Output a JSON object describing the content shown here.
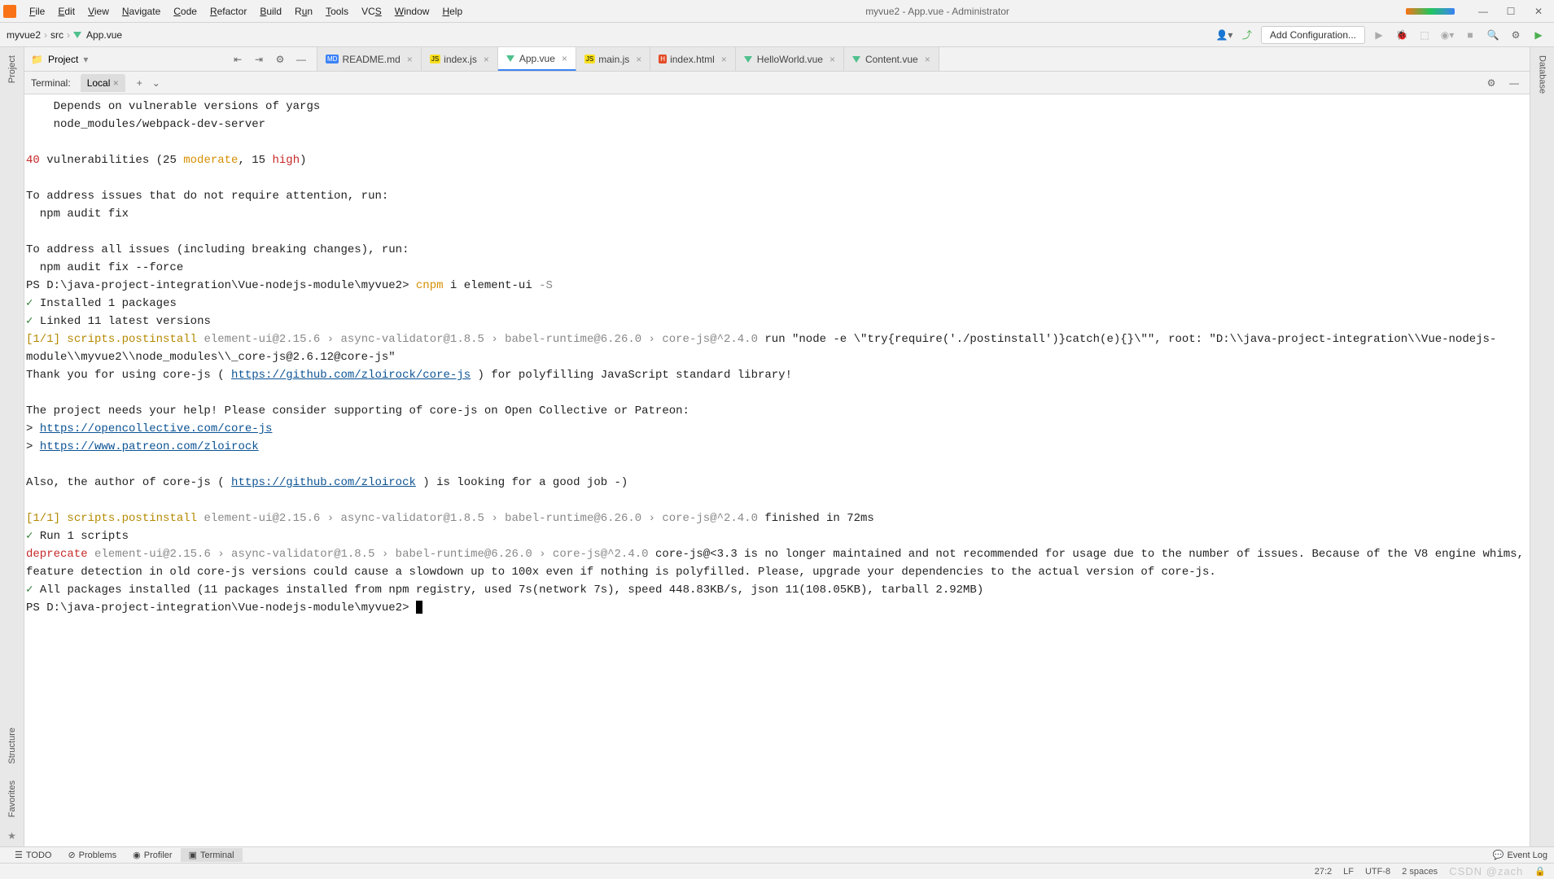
{
  "window": {
    "title": "myvue2 - App.vue - Administrator"
  },
  "menus": [
    "File",
    "Edit",
    "View",
    "Navigate",
    "Code",
    "Refactor",
    "Build",
    "Run",
    "Tools",
    "VCS",
    "Window",
    "Help"
  ],
  "breadcrumb": {
    "project": "myvue2",
    "folder": "src",
    "file": "App.vue"
  },
  "toolbar": {
    "add_configuration": "Add Configuration..."
  },
  "project_panel": {
    "label": "Project"
  },
  "tabs": [
    {
      "label": "README.md",
      "icon": "md",
      "active": false
    },
    {
      "label": "index.js",
      "icon": "js",
      "active": false
    },
    {
      "label": "App.vue",
      "icon": "vue",
      "active": true
    },
    {
      "label": "main.js",
      "icon": "js",
      "active": false
    },
    {
      "label": "index.html",
      "icon": "html",
      "active": false
    },
    {
      "label": "HelloWorld.vue",
      "icon": "vue",
      "active": false
    },
    {
      "label": "Content.vue",
      "icon": "vue",
      "active": false
    }
  ],
  "left_stripe": [
    "Project"
  ],
  "left_bottom_stripe": [
    "Structure",
    "Favorites"
  ],
  "right_stripe": [
    "Database"
  ],
  "terminal": {
    "header_label": "Terminal:",
    "tab_label": "Local",
    "lines": {
      "depends": "    Depends on vulnerable versions of yargs",
      "nodemodules": "    node_modules/webpack-dev-server",
      "vuln_count": "40",
      "vuln_rest": " vulnerabilities (25 ",
      "moderate": "moderate",
      "vuln_mid": ", 15 ",
      "high": "high",
      "vuln_end": ")",
      "audit1": "To address issues that do not require attention, run:",
      "audit1a": "  npm audit fix",
      "audit2": "To address all issues (including breaking changes), run:",
      "audit2a": "  npm audit fix --force",
      "prompt1_pre": "PS D:\\java-project-integration\\Vue-nodejs-module\\myvue2> ",
      "cnpm": "cnpm",
      "prompt1_post": " i element-ui ",
      "flag_s": "-S",
      "installed": "Installed 1 packages",
      "linked": "Linked 11 latest versions",
      "tag1": "[1/1]",
      "scripts1": "scripts.postinstall",
      "chain_gray": " element-ui@2.15.6 › async-validator@1.8.5 › babel-runtime@6.26.0 › core-js@^2.4.0 ",
      "run_str": "run \"node -e \\\"try{require('./postinstall')}catch(e){}\\\"\", root: \"D:\\\\java-project-integration\\\\Vue-nodejs-module\\\\myvue2\\\\node_modules\\\\_core-js@2.6.12@core-js\"",
      "thank": "Thank you for using core-js ( ",
      "url_corejs": "https://github.com/zloirock/core-js",
      "thank_post": " ) for polyfilling JavaScript standard library!",
      "support": "The project needs your help! Please consider supporting of core-js on Open Collective or Patreon:",
      "gt1": "> ",
      "url_oc": "https://opencollective.com/core-js",
      "url_patreon": "https://www.patreon.com/zloirock",
      "also": "Also, the author of core-js ( ",
      "url_author": "https://github.com/zloirock",
      "also_post": " ) is looking for a good job -)",
      "finished": "finished in 72ms",
      "run1": "Run 1 scripts",
      "deprecate": "deprecate",
      "deprecate_chain": " element-ui@2.15.6 › async-validator@1.8.5 › babel-runtime@6.26.0 › core-js@^2.4.0 ",
      "deprecate_msg": "core-js@<3.3 is no longer maintained and not recommended for usage due to the number of issues. Because of the V8 engine whims, feature detection in old core-js versions could cause a slowdown up to 100x even if nothing is polyfilled. Please, upgrade your dependencies to the actual version of core-js.",
      "all_installed": "All packages installed (11 packages installed from npm registry, used 7s(network 7s), speed 448.83KB/s, json 11(108.05KB), tarball 2.92MB)",
      "prompt2": "PS D:\\java-project-integration\\Vue-nodejs-module\\myvue2> "
    }
  },
  "bottom_tools": {
    "todo": "TODO",
    "problems": "Problems",
    "profiler": "Profiler",
    "terminal": "Terminal",
    "event_log": "Event Log"
  },
  "status": {
    "pos": "27:2",
    "le": "LF",
    "enc": "UTF-8",
    "indent": "2 spaces"
  },
  "watermark": "CSDN @zach"
}
